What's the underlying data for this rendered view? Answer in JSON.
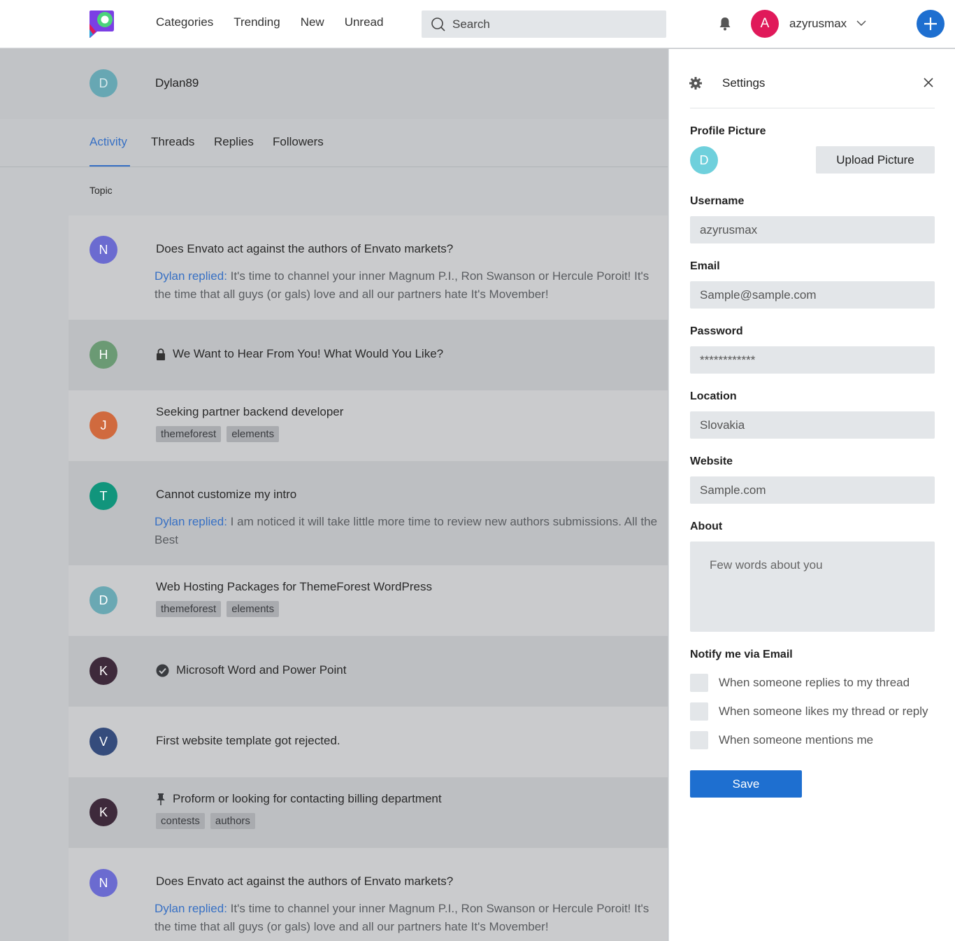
{
  "header": {
    "nav": [
      "Categories",
      "Trending",
      "New",
      "Unread"
    ],
    "search_placeholder": "Search",
    "user_initial": "A",
    "username": "azyrusmax",
    "colors": {
      "accent": "#1e6fd0",
      "avatar": "#e0195a"
    }
  },
  "profile": {
    "initial": "D",
    "name": "Dylan89"
  },
  "tabs": [
    "Activity",
    "Threads",
    "Replies",
    "Followers"
  ],
  "topic_label": "Topic",
  "threads": [
    {
      "initial": "N",
      "color": "#6b6bd0",
      "icon": "",
      "title": "Does Envato act against the authors of Envato markets?",
      "reply_author": "Dylan replied:",
      "reply_text": " It's time to channel your inner Magnum P.I., Ron Swanson or Hercule Poroit! It's the time that all guys (or gals) love and all our partners hate It's Movember!",
      "tags": []
    },
    {
      "initial": "H",
      "color": "#6b9a74",
      "icon": "lock-icon",
      "title": "We Want to Hear From You! What Would You Like?",
      "reply_author": "",
      "reply_text": "",
      "tags": []
    },
    {
      "initial": "J",
      "color": "#d06a3e",
      "icon": "",
      "title": "Seeking partner backend developer",
      "reply_author": "",
      "reply_text": "",
      "tags": [
        "themeforest",
        "elements"
      ]
    },
    {
      "initial": "T",
      "color": "#11957c",
      "icon": "",
      "title": "Cannot customize my intro",
      "reply_author": "Dylan replied:",
      "reply_text": " I am noticed it will take little more time to review new authors submissions. All the Best",
      "tags": []
    },
    {
      "initial": "D",
      "color": "#6aa8b3",
      "icon": "",
      "title": "Web Hosting Packages for ThemeForest WordPress",
      "reply_author": "",
      "reply_text": "",
      "tags": [
        "themeforest",
        "elements"
      ]
    },
    {
      "initial": "K",
      "color": "#3e2a3b",
      "icon": "check-circle-icon",
      "title": "Microsoft Word and Power Point",
      "reply_author": "",
      "reply_text": "",
      "tags": []
    },
    {
      "initial": "V",
      "color": "#354c7c",
      "icon": "",
      "title": "First website template got rejected.",
      "reply_author": "",
      "reply_text": "",
      "tags": []
    },
    {
      "initial": "K",
      "color": "#3e2a3b",
      "icon": "pin-icon",
      "title": "Proform or looking for contacting billing department",
      "reply_author": "",
      "reply_text": "",
      "tags": [
        "contests",
        "authors"
      ]
    },
    {
      "initial": "N",
      "color": "#6b6bd0",
      "icon": "",
      "title": "Does Envato act against the authors of Envato markets?",
      "reply_author": "Dylan replied:",
      "reply_text": " It's time to channel your inner Magnum P.I., Ron Swanson or Hercule Poroit! It's the time that all guys (or gals) love and all our partners hate It's Movember!",
      "tags": []
    }
  ],
  "settings": {
    "title": "Settings",
    "profile_picture_label": "Profile Picture",
    "picture_initial": "D",
    "upload_label": "Upload Picture",
    "username_label": "Username",
    "username_value": "azyrusmax",
    "email_label": "Email",
    "email_value": "Sample@sample.com",
    "password_label": "Password",
    "password_value": "************",
    "location_label": "Location",
    "location_value": "Slovakia",
    "website_label": "Website",
    "website_value": "Sample.com",
    "about_label": "About",
    "about_placeholder": "Few words about you",
    "notify_label": "Notify me via Email",
    "notify_options": [
      "When someone replies to my thread",
      "When someone likes my thread or reply",
      "When someone mentions me"
    ],
    "save_label": "Save"
  }
}
